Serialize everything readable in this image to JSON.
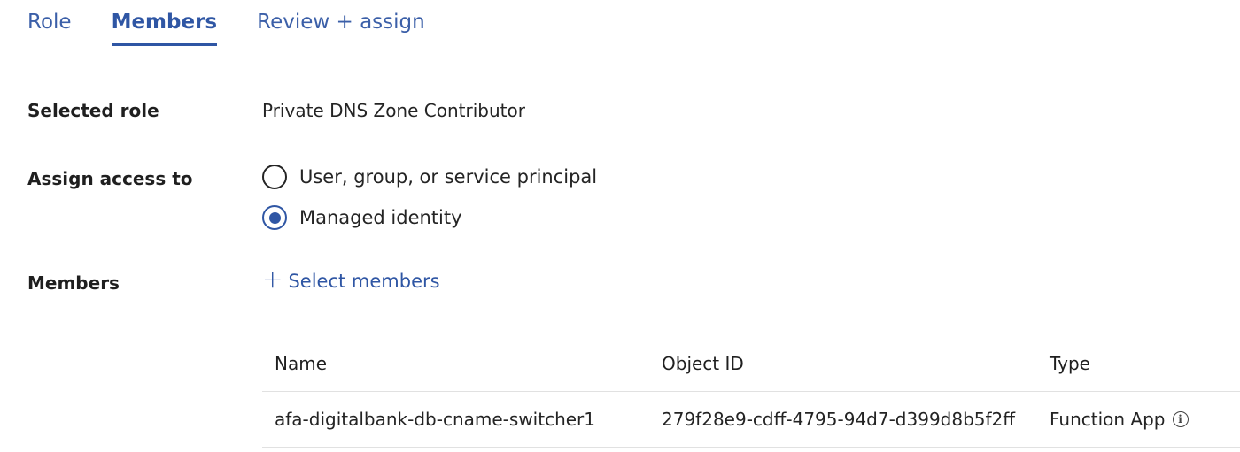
{
  "tabs": [
    {
      "label": "Role",
      "active": false
    },
    {
      "label": "Members",
      "active": true
    },
    {
      "label": "Review + assign",
      "active": false
    }
  ],
  "form": {
    "selected_role": {
      "label": "Selected role",
      "value": "Private DNS Zone Contributor"
    },
    "assign_access_to": {
      "label": "Assign access to",
      "options": [
        {
          "label": "User, group, or service principal",
          "checked": false
        },
        {
          "label": "Managed identity",
          "checked": true
        }
      ]
    },
    "members": {
      "label": "Members",
      "select_link": "Select members",
      "icon": "plus-icon"
    }
  },
  "table": {
    "columns": [
      "Name",
      "Object ID",
      "Type"
    ],
    "rows": [
      {
        "name": "afa-digitalbank-db-cname-switcher1",
        "object_id": "279f28e9-cdff-4795-94d7-d399d8b5f2ff",
        "type": "Function App",
        "type_icon": "info-icon"
      }
    ]
  },
  "colors": {
    "accent": "#2f56a4",
    "text": "#242424",
    "divider": "#e1e1e1"
  }
}
